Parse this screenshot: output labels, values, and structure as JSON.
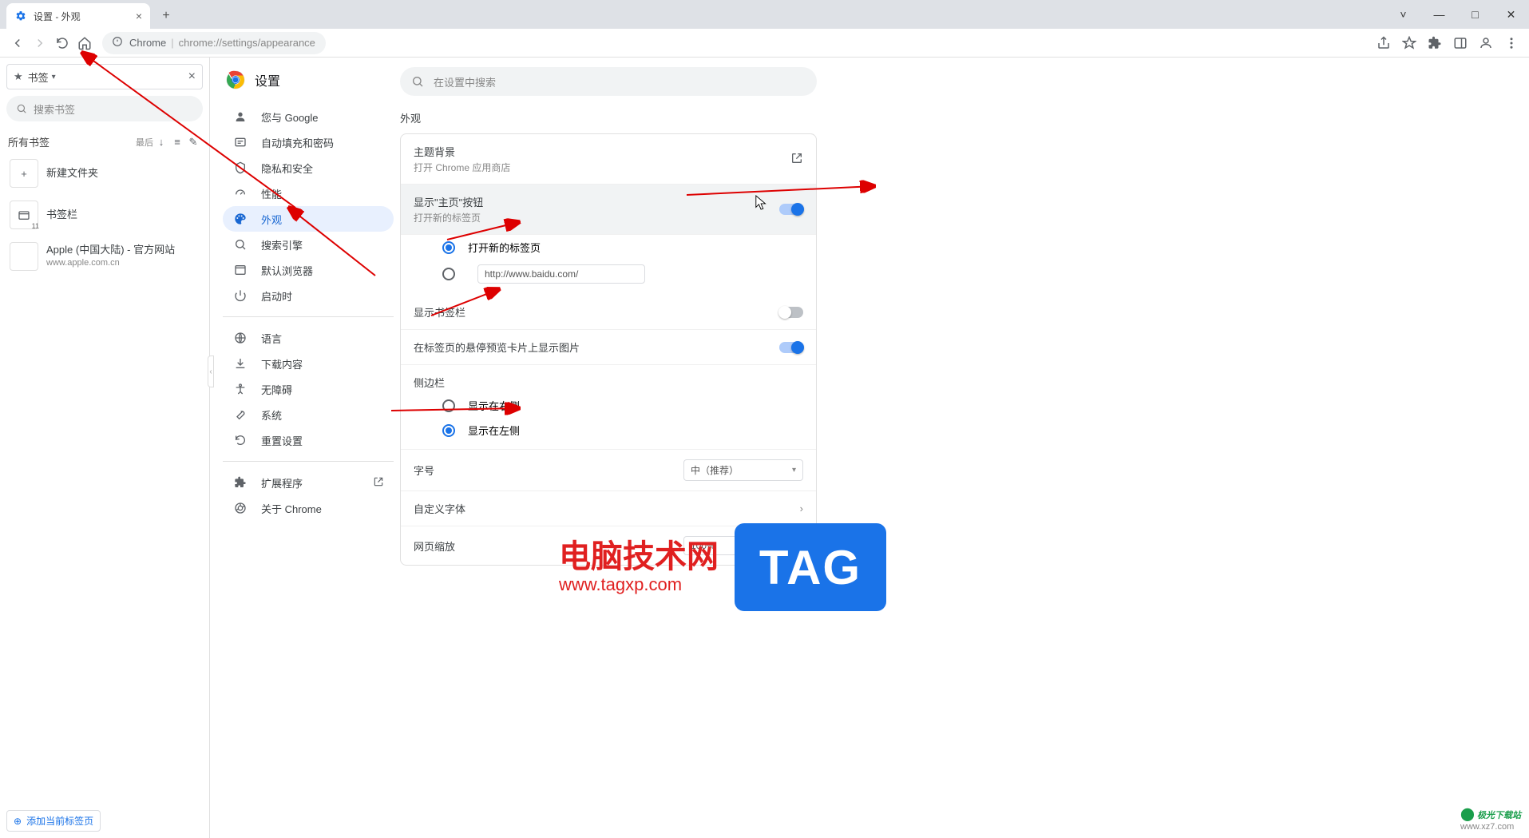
{
  "tab": {
    "title": "设置 - 外观"
  },
  "window": {
    "minimize": "—",
    "maximize": "□",
    "close": "✕"
  },
  "addr": {
    "chrome_label": "Chrome",
    "url": "chrome://settings/appearance"
  },
  "bookmarks_panel": {
    "header": "书签",
    "search_placeholder": "搜索书签",
    "all_label": "所有书签",
    "sort_label": "最后",
    "new_folder": "新建文件夹",
    "bar_label": "书签栏",
    "bar_count": "11",
    "apple_title": "Apple (中国大陆) - 官方网站",
    "apple_url": "www.apple.com.cn",
    "add_current": "添加当前标签页"
  },
  "settings": {
    "title": "设置",
    "search_placeholder": "在设置中搜索",
    "nav": {
      "you_google": "您与 Google",
      "autofill": "自动填充和密码",
      "privacy": "隐私和安全",
      "performance": "性能",
      "appearance": "外观",
      "search_engine": "搜索引擎",
      "default_browser": "默认浏览器",
      "startup": "启动时",
      "language": "语言",
      "downloads": "下载内容",
      "accessibility": "无障碍",
      "system": "系统",
      "reset": "重置设置",
      "extensions": "扩展程序",
      "about": "关于 Chrome"
    },
    "section_title": "外观",
    "theme": {
      "title": "主题背景",
      "sub": "打开 Chrome 应用商店"
    },
    "home_btn": {
      "title": "显示\"主页\"按钮",
      "sub": "打开新的标签页",
      "on": true
    },
    "home_radio": {
      "new_tab": "打开新的标签页",
      "custom_url": "http://www.baidu.com/"
    },
    "bookmarks_bar": {
      "title": "显示书签栏",
      "on": false
    },
    "hover_cards": {
      "title": "在标签页的悬停预览卡片上显示图片",
      "on": true
    },
    "side_panel": {
      "title": "侧边栏",
      "right": "显示在右侧",
      "left": "显示在左侧"
    },
    "font_size": {
      "title": "字号",
      "value": "中（推荐）"
    },
    "custom_fonts": "自定义字体",
    "page_zoom": {
      "title": "网页缩放",
      "value": "100%"
    }
  },
  "watermark": {
    "title": "电脑技术网",
    "url": "www.tagxp.com",
    "tag": "TAG"
  },
  "jg": {
    "name": "极光下载站",
    "url": "www.xz7.com"
  }
}
